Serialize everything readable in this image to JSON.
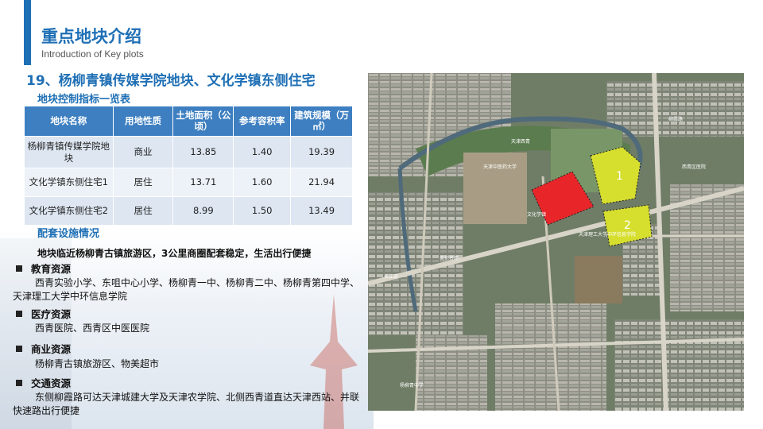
{
  "header": {
    "title": "重点地块介绍",
    "subtitle": "Introduction of Key plots"
  },
  "heading": "19、杨柳青镇传媒学院地块、文化学镇东侧住宅",
  "table": {
    "title": "地块控制指标一览表",
    "headers": [
      "地块名称",
      "用地性质",
      "土地面积（公顷）",
      "参考容积率",
      "建筑规模（万㎡）"
    ],
    "rows": [
      [
        "杨柳青镇传媒学院地块",
        "商业",
        "13.85",
        "1.40",
        "19.39"
      ],
      [
        "文化学镇东侧住宅1",
        "居住",
        "13.71",
        "1.60",
        "21.94"
      ],
      [
        "文化学镇东侧住宅2",
        "居住",
        "8.99",
        "1.50",
        "13.49"
      ]
    ]
  },
  "facilities": {
    "title": "配套设施情况",
    "summary": "地块临近杨柳青古镇旅游区，3公里商圈配套稳定，生活出行便捷",
    "sections": [
      {
        "name": "教育资源",
        "text": "西青实验小学、东咀中心小学、杨柳青一中、杨柳青二中、杨柳青第四中学、天津理工大学中环信息学院"
      },
      {
        "name": "医疗资源",
        "text": "西青医院、西青区中医医院"
      },
      {
        "name": "商业资源",
        "text": "杨柳青古镇旅游区、物美超市"
      },
      {
        "name": "交通资源",
        "text": "东侧柳霞路可达天津城建大学及天津农学院、北侧西青道直达天津西站、并联快速路出行便捷"
      }
    ]
  },
  "map": {
    "plot_labels": [
      "1",
      "2"
    ],
    "place_labels": [
      "天津西青",
      "天津中医药大学",
      "文化学镇",
      "英伦名苑",
      "杨柳青中学",
      "天津理工大学中环信息学院",
      "西青区医院",
      "长江道",
      "柳霞路"
    ],
    "colors": {
      "plot_red": "#e8262a",
      "plot_yellow": "#d6de2e"
    }
  },
  "colors": {
    "accent": "#1e6fb5",
    "table_header": "#3d7fc1"
  }
}
